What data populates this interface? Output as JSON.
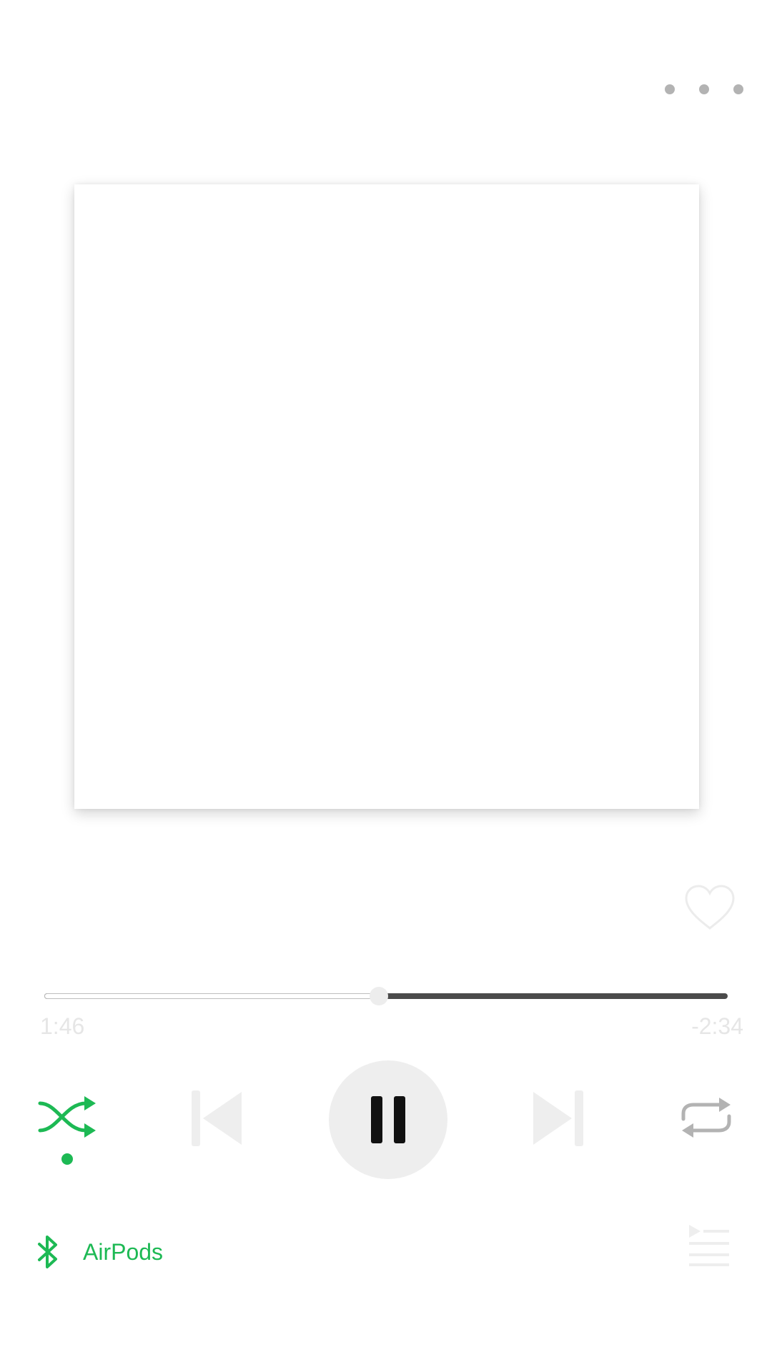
{
  "header": {
    "more_icon": "more-horizontal-icon"
  },
  "track": {
    "liked": false,
    "like_icon": "heart-outline-icon"
  },
  "progress": {
    "elapsed": "1:46",
    "remaining": "-2:34",
    "fraction": 0.49
  },
  "controls": {
    "shuffle_icon": "shuffle-icon",
    "shuffle_active": true,
    "previous_icon": "skip-previous-icon",
    "play_state": "playing",
    "pause_icon": "pause-icon",
    "next_icon": "skip-next-icon",
    "repeat_icon": "repeat-icon",
    "repeat_active": false
  },
  "device": {
    "name": "AirPods",
    "icon": "bluetooth-icon"
  },
  "queue": {
    "icon": "queue-icon"
  },
  "colors": {
    "accent": "#1db954",
    "inactive": "#b3b3b3",
    "disabled": "#eeeeee",
    "dark": "#111111"
  }
}
